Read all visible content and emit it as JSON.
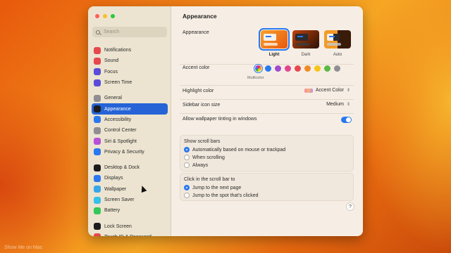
{
  "sidebar": {
    "search_placeholder": "Search",
    "groups": [
      [
        {
          "label": "Notifications",
          "icon": "bell-icon",
          "color": "#e5484d"
        },
        {
          "label": "Sound",
          "icon": "speaker-icon",
          "color": "#e5484d"
        },
        {
          "label": "Focus",
          "icon": "moon-icon",
          "color": "#5b4bd8"
        },
        {
          "label": "Screen Time",
          "icon": "hourglass-icon",
          "color": "#5b4bd8"
        }
      ],
      [
        {
          "label": "General",
          "icon": "gear-icon",
          "color": "#8e8e93"
        },
        {
          "label": "Appearance",
          "icon": "appearance-icon",
          "color": "#1c1c1e",
          "active": true
        },
        {
          "label": "Accessibility",
          "icon": "accessibility-icon",
          "color": "#2a78f0"
        },
        {
          "label": "Control Center",
          "icon": "control-center-icon",
          "color": "#8e8e93"
        },
        {
          "label": "Siri & Spotlight",
          "icon": "siri-icon",
          "color": "#b84fd8"
        },
        {
          "label": "Privacy & Security",
          "icon": "hand-icon",
          "color": "#2a78f0"
        }
      ],
      [
        {
          "label": "Desktop & Dock",
          "icon": "dock-icon",
          "color": "#1c1c1e"
        },
        {
          "label": "Displays",
          "icon": "display-icon",
          "color": "#2a78f0"
        },
        {
          "label": "Wallpaper",
          "icon": "wallpaper-icon",
          "color": "#37a7e8"
        },
        {
          "label": "Screen Saver",
          "icon": "screensaver-icon",
          "color": "#37c0e8"
        },
        {
          "label": "Battery",
          "icon": "battery-icon",
          "color": "#34c759"
        }
      ],
      [
        {
          "label": "Lock Screen",
          "icon": "lock-icon",
          "color": "#1c1c1e"
        },
        {
          "label": "Touch ID & Password",
          "icon": "fingerprint-icon",
          "color": "#e5484d"
        }
      ]
    ]
  },
  "main": {
    "title": "Appearance",
    "appearance": {
      "label": "Appearance",
      "options": [
        {
          "label": "Light",
          "selected": true
        },
        {
          "label": "Dark",
          "selected": false
        },
        {
          "label": "Auto",
          "selected": false
        }
      ]
    },
    "accent": {
      "label": "Accent color",
      "selected_caption": "Multicolor",
      "colors": [
        "multi",
        "#2a78f0",
        "#a04ad0",
        "#e0468f",
        "#e5484d",
        "#f08a24",
        "#f5c518",
        "#5ab946",
        "#8e8e93"
      ]
    },
    "highlight": {
      "label": "Highlight color",
      "value": "Accent Color"
    },
    "sidebar_icon_size": {
      "label": "Sidebar icon size",
      "value": "Medium"
    },
    "wallpaper_tinting": {
      "label": "Allow wallpaper tinting in windows",
      "enabled": true
    },
    "scroll_bars": {
      "title": "Show scroll bars",
      "options": [
        {
          "label": "Automatically based on mouse or trackpad",
          "selected": true
        },
        {
          "label": "When scrolling",
          "selected": false
        },
        {
          "label": "Always",
          "selected": false
        }
      ]
    },
    "click_scroll": {
      "title": "Click in the scroll bar to",
      "options": [
        {
          "label": "Jump to the next page",
          "selected": true
        },
        {
          "label": "Jump to the spot that's clicked",
          "selected": false
        }
      ]
    },
    "help_label": "?"
  },
  "watermark": "Show Me on Mac"
}
